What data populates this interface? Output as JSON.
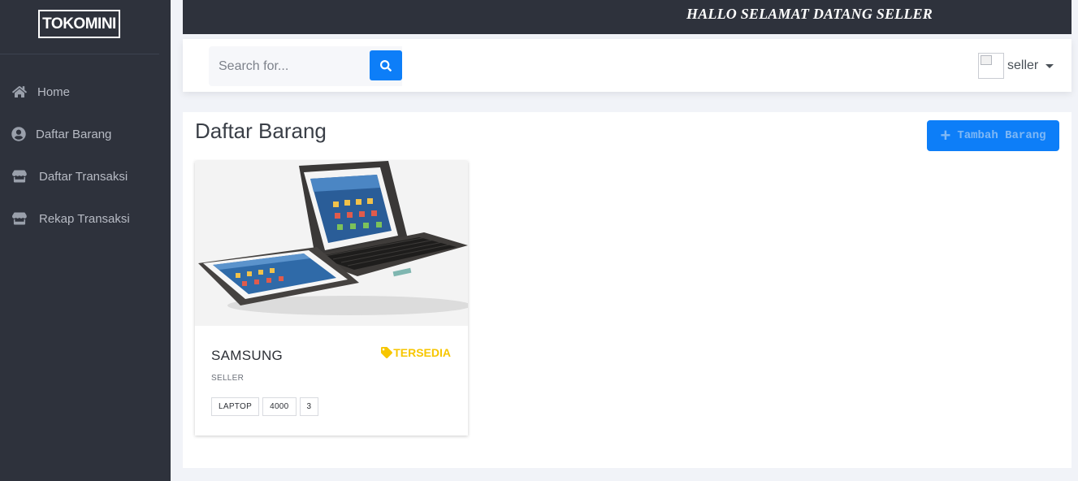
{
  "sidebar": {
    "brand": "TOKOMINI",
    "items": [
      {
        "label": "Home",
        "icon": "home-icon"
      },
      {
        "label": "Daftar Barang",
        "icon": "user-circle-icon"
      },
      {
        "label": "Daftar Transaksi",
        "icon": "store-icon"
      },
      {
        "label": "Rekap Transaksi",
        "icon": "store-icon"
      }
    ]
  },
  "topbar": {
    "welcome": "HALLO SELAMAT DATANG SELLER"
  },
  "navbar": {
    "search_placeholder": "Search for...",
    "search_value": "",
    "user_name": "seller"
  },
  "main": {
    "title": "Daftar Barang",
    "add_button": "Tambah Barang"
  },
  "products": [
    {
      "name": "SAMSUNG",
      "status": "TERSEDIA",
      "seller": "SELLER",
      "tags": [
        "LAPTOP",
        "4000",
        "3"
      ],
      "image": "tablet-keyboard-case-photo"
    }
  ],
  "colors": {
    "sidebar_bg": "#2e323c",
    "accent": "#0d7ef8",
    "status": "#f7c600"
  }
}
